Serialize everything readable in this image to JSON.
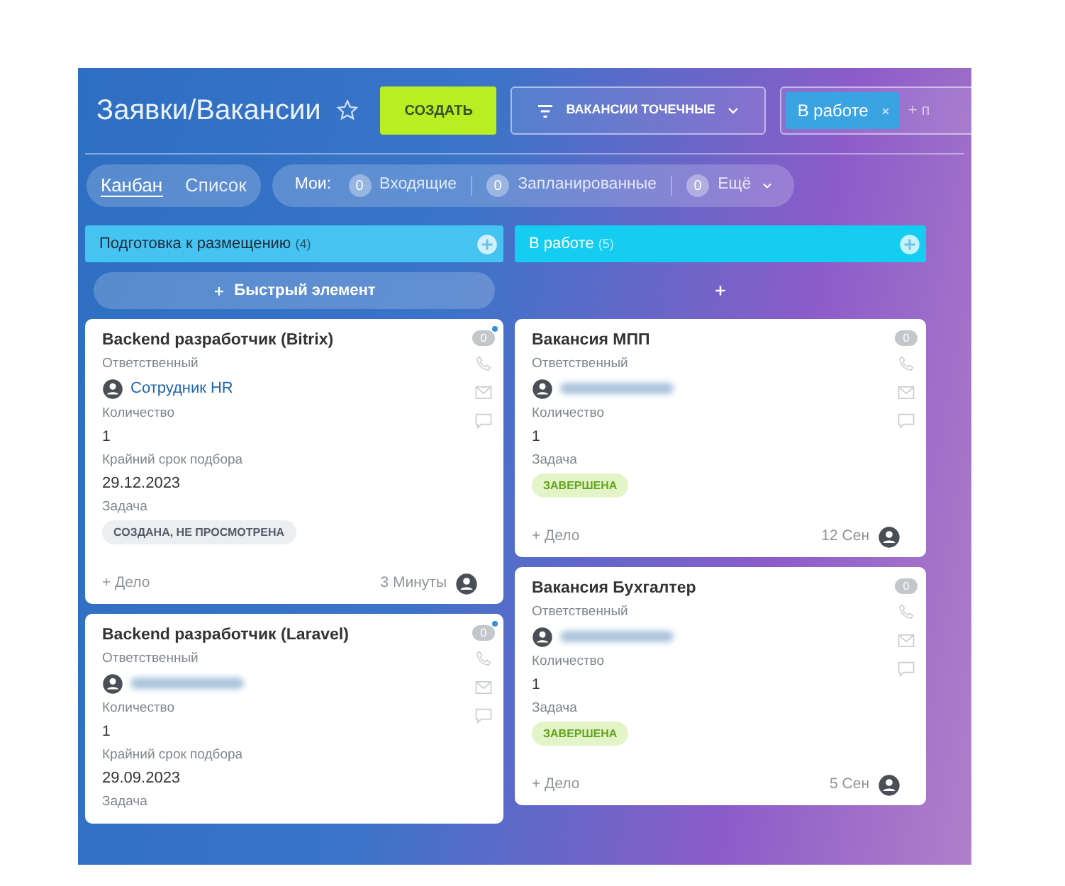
{
  "header": {
    "title": "Заявки/Вакансии",
    "create_button": "СОЗДАТЬ",
    "filter_button": "ВАКАНСИИ ТОЧЕЧНЫЕ",
    "search": {
      "tags": [
        {
          "label": "В работе"
        }
      ],
      "overflow_text": "+ п"
    }
  },
  "views": [
    {
      "label": "Канбан",
      "selected": true
    },
    {
      "label": "Список",
      "selected": false
    }
  ],
  "counters": {
    "label": "Мои:",
    "items": [
      {
        "count": "0",
        "label": "Входящие",
        "dropdown": false
      },
      {
        "count": "0",
        "label": "Запланированные",
        "dropdown": false
      },
      {
        "count": "0",
        "label": "Ещё",
        "dropdown": true
      }
    ]
  },
  "columns": [
    {
      "title": "Подготовка к размещению",
      "count": "(4)",
      "color": "#45c4f2",
      "quick_add": "Быстрый элемент",
      "cards": [
        {
          "title": "Backend разработчик (Bitrix)",
          "counter": "0",
          "counter_dot": true,
          "fields": [
            {
              "kind": "person",
              "label": "Ответственный",
              "blurred": false,
              "name": "Сотрудник HR"
            },
            {
              "kind": "text",
              "label": "Количество",
              "value": "1"
            },
            {
              "kind": "date",
              "label": "Крайний срок подбора",
              "value": "29.12.2023"
            },
            {
              "kind": "task",
              "label": "Задача",
              "status": "СОЗДАНА, НЕ ПРОСМОТРЕНА",
              "completed": false
            }
          ],
          "footer": {
            "add": "+ Дело",
            "time": "3 Минуты"
          }
        },
        {
          "title": "Backend разработчик (Laravel)",
          "counter": "0",
          "counter_dot": true,
          "fields": [
            {
              "kind": "person",
              "label": "Ответственный",
              "blurred": true
            },
            {
              "kind": "text",
              "label": "Количество",
              "value": "1"
            },
            {
              "kind": "date",
              "label": "Крайний срок подбора",
              "value": "29.09.2023"
            },
            {
              "kind": "task",
              "label": "Задача"
            }
          ]
        }
      ]
    },
    {
      "title": "В работе",
      "count": "(5)",
      "color": "#14cdf0",
      "cards": [
        {
          "title": "Вакансия МПП",
          "counter": "0",
          "counter_dot": false,
          "fields": [
            {
              "kind": "person",
              "label": "Ответственный",
              "blurred": true
            },
            {
              "kind": "text",
              "label": "Количество",
              "value": "1"
            },
            {
              "kind": "task",
              "label": "Задача",
              "status": "ЗАВЕРШЕНА",
              "completed": true
            }
          ],
          "footer": {
            "add": "+ Дело",
            "time": "12 Сен"
          }
        },
        {
          "title": "Вакансия Бухгалтер",
          "counter": "0",
          "counter_dot": false,
          "fields": [
            {
              "kind": "person",
              "label": "Ответственный",
              "blurred": true
            },
            {
              "kind": "text",
              "label": "Количество",
              "value": "1"
            },
            {
              "kind": "task",
              "label": "Задача",
              "status": "ЗАВЕРШЕНА",
              "completed": true
            }
          ],
          "footer": {
            "add": "+ Дело",
            "time": "5 Сен"
          }
        }
      ]
    }
  ]
}
